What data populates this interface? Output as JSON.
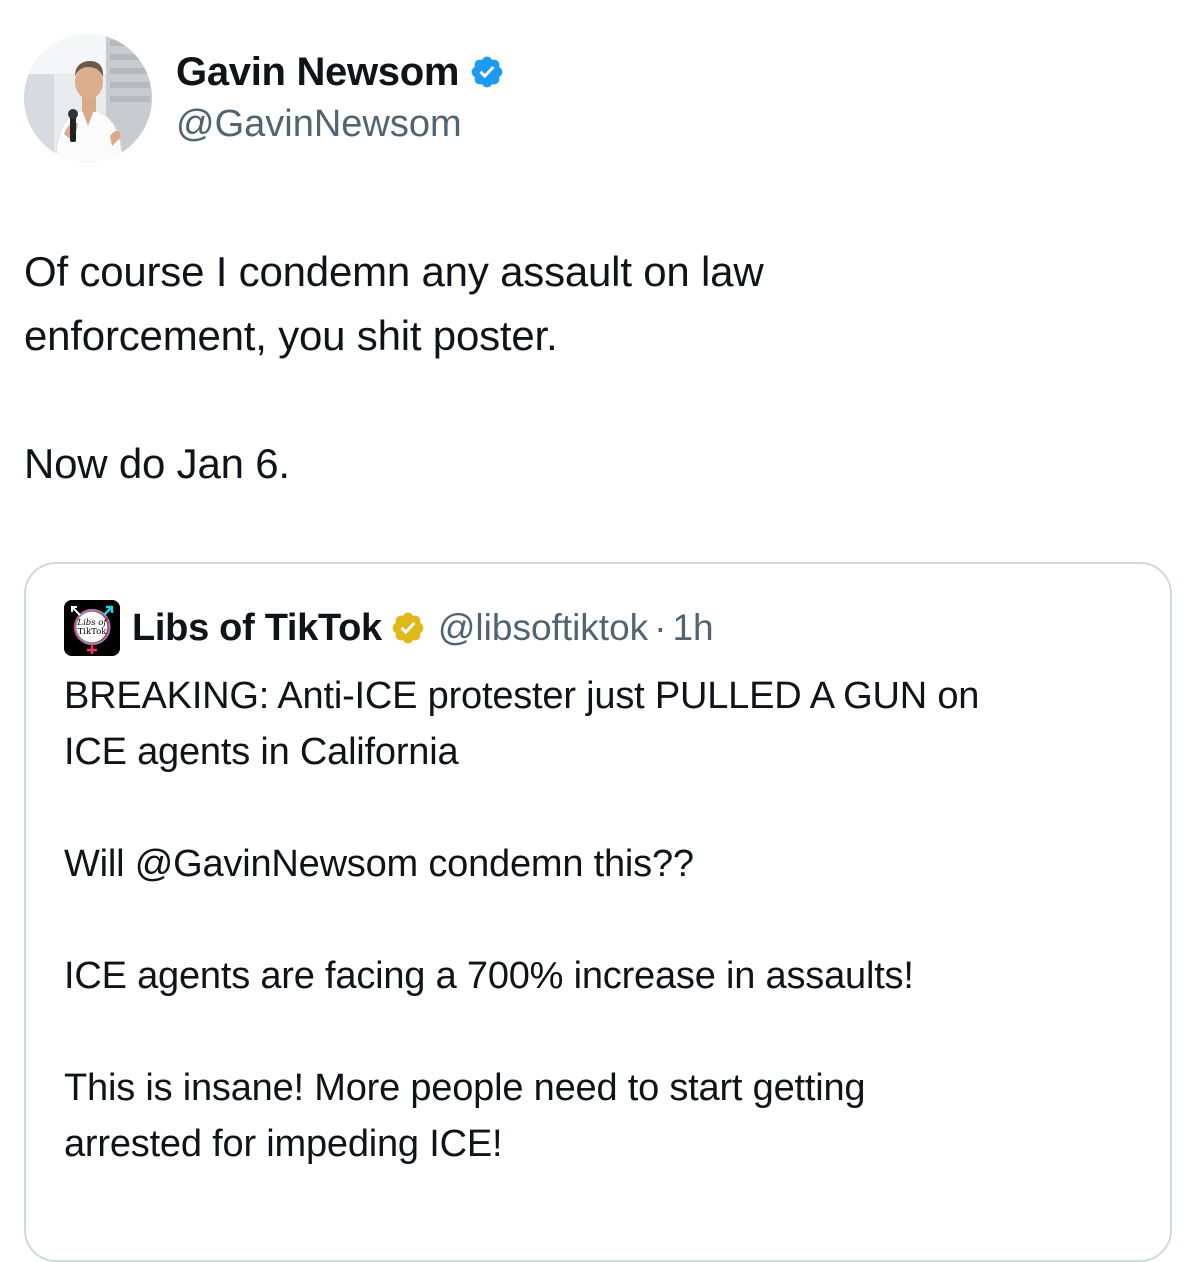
{
  "tweet": {
    "author": {
      "name": "Gavin Newsom",
      "handle": "@GavinNewsom",
      "verified_badge": "blue-verified-checkmark-icon",
      "avatar": "photo of man in white shirt holding microphone"
    },
    "paragraphs": [
      "Of course I condemn any assault on law\nenforcement, you shit poster.",
      "Now do Jan 6."
    ]
  },
  "quoted_tweet": {
    "author": {
      "name": "Libs of TikTok",
      "handle": "@libsoftiktok",
      "separator": "·",
      "time": "1h",
      "verified_badge": "gold-verified-checkmark-icon",
      "avatar_text": [
        "Libs of",
        "TikTok"
      ]
    },
    "paragraphs": [
      "BREAKING: Anti-ICE protester just PULLED A GUN on\nICE agents in California",
      "Will @GavinNewsom condemn this??",
      "ICE agents are facing a 700% increase in assaults!",
      "This is insane! More people need to start getting\narrested for impeding ICE!"
    ]
  },
  "colors": {
    "text_primary": "#0f1419",
    "text_secondary": "#536471",
    "border": "#cfd9de",
    "verified_blue": "#1d9bf0",
    "verified_gold": "#e2b719"
  }
}
